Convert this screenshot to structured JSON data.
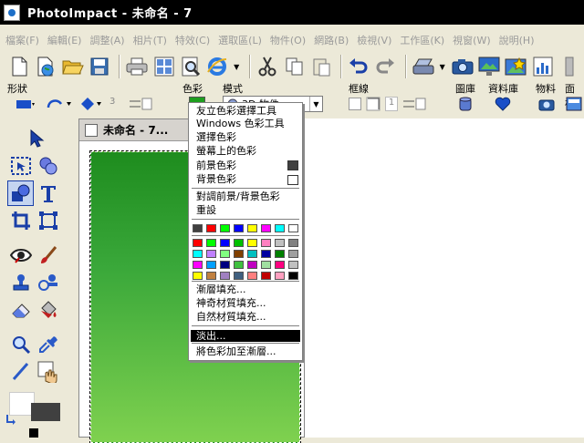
{
  "titlebar": {
    "title": "PhotoImpact - 未命名 - 7"
  },
  "menubar": {
    "items": [
      "檔案(F)",
      "編輯(E)",
      "調整(A)",
      "相片(T)",
      "特效(C)",
      "選取區(L)",
      "物件(O)",
      "網路(B)",
      "檢視(V)",
      "工作區(K)",
      "視窗(W)",
      "說明(H)"
    ]
  },
  "attrbar": {
    "shape_label": "形狀",
    "color_label": "色彩",
    "mode_label": "模式",
    "mode_value": "3D 物件",
    "border_label": "框線",
    "border_value": "1",
    "layer_label": "圖庫",
    "library_label": "資料庫",
    "material_label": "物料",
    "panel_label": "面板",
    "shape_count": "3"
  },
  "document": {
    "title": "未命名 - 7..."
  },
  "context_menu": {
    "items": {
      "friendly_picker": "友立色彩選擇工具",
      "windows_picker": "Windows 色彩工具",
      "pick_color": "選擇色彩",
      "screen_color": "螢幕上的色彩",
      "foreground": "前景色彩",
      "background": "背景色彩",
      "swap": "對調前景/背景色彩",
      "reset": "重設",
      "gradient_fill": "漸層填充...",
      "magic_texture": "神奇材質填充...",
      "natural_texture": "自然材質填充...",
      "fade_out": "淡出...",
      "add_to_gradient": "將色彩加至漸層..."
    },
    "recent_colors": [
      "#404040",
      "#ff0000",
      "#00ff00",
      "#0000ff",
      "#ffff00",
      "#ff00ff",
      "#00ffff",
      "#ffffff"
    ],
    "palette_colors": [
      "#ff0000",
      "#00ff00",
      "#0000ff",
      "#00c000",
      "#ffff00",
      "#ff80c0",
      "#c0c0c0",
      "#808080",
      "#00ffff",
      "#c080ff",
      "#80ff80",
      "#804000",
      "#00c0c0",
      "#0000a0",
      "#008000",
      "#a0a0a0",
      "#ff00ff",
      "#00a0ff",
      "#000080",
      "#40c040",
      "#c000c0",
      "#a0e0a0",
      "#ff0080",
      "#c0c0c0",
      "#ffff00",
      "#c08040",
      "#a080c0",
      "#406080",
      "#ff8080",
      "#c00000",
      "#ffa0c0",
      "#000000"
    ],
    "foreground_color": "#404040",
    "background_color": "#ffffff"
  },
  "colors": {
    "titlebar_bg": "#000000",
    "canvas_top": "#1e8c1e",
    "canvas_bottom": "#7fd14f",
    "highlight": "#000000"
  }
}
